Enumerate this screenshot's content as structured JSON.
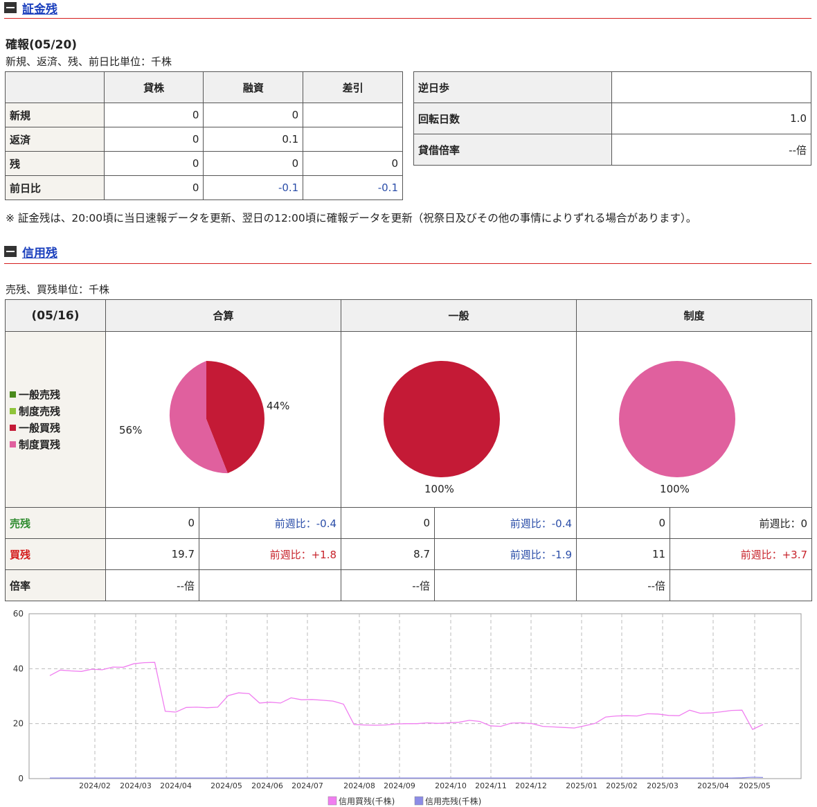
{
  "shoukin": {
    "title": "証金残",
    "status": "確報(05/20)",
    "unit_note": "新規、返済、残、前日比単位：千株",
    "columns": [
      "貸株",
      "融資",
      "差引"
    ],
    "rows": [
      {
        "label": "新規",
        "values": [
          "0",
          "0",
          ""
        ]
      },
      {
        "label": "返済",
        "values": [
          "0",
          "0.1",
          ""
        ]
      },
      {
        "label": "残",
        "values": [
          "0",
          "0",
          "0"
        ]
      },
      {
        "label": "前日比",
        "values": [
          "0",
          "-0.1",
          "-0.1"
        ]
      }
    ],
    "side": [
      {
        "label": "逆日歩",
        "value": ""
      },
      {
        "label": "回転日数",
        "value": "1.0"
      },
      {
        "label": "貸借倍率",
        "value": "--倍"
      }
    ],
    "note": "※ 証金残は、20:00頃に当日速報データを更新、翌日の12:00頃に確報データを更新（祝祭日及びその他の事情によりずれる場合があります）。"
  },
  "shinyou": {
    "title": "信用残",
    "unit_note": "売残、買残単位：千株",
    "date": "(05/16)",
    "columns": [
      "合算",
      "一般",
      "制度"
    ],
    "legend": [
      {
        "label": "一般売残",
        "color": "#4a8a1c"
      },
      {
        "label": "制度売残",
        "color": "#8fc43a"
      },
      {
        "label": "一般買残",
        "color": "#c41a36"
      },
      {
        "label": "制度買残",
        "color": "#e0609e"
      }
    ],
    "pie_labels": {
      "gassan_a": "44%",
      "gassan_b": "56%",
      "ippan": "100%",
      "seido": "100%"
    },
    "rows": {
      "uri": {
        "label": "売残",
        "cells": [
          "0",
          "前週比：-0.4",
          "0",
          "前週比：-0.4",
          "0",
          "前週比：0"
        ]
      },
      "kai": {
        "label": "買残",
        "cells": [
          "19.7",
          "前週比：+1.8",
          "8.7",
          "前週比：-1.9",
          "11",
          "前週比：+3.7"
        ]
      },
      "bai": {
        "label": "倍率",
        "cells": [
          "--倍",
          "",
          "--倍",
          "",
          "--倍",
          ""
        ]
      }
    }
  },
  "chart_data": {
    "type": "line",
    "ylim": [
      0,
      60
    ],
    "yticks": [
      "0",
      "20",
      "40",
      "60"
    ],
    "xticks": [
      "2024/02",
      "2024/03",
      "2024/04",
      "2024/05",
      "2024/06",
      "2024/07",
      "2024/08",
      "2024/09",
      "2024/10",
      "2024/11",
      "2024/12",
      "2025/01",
      "2025/02",
      "2025/03",
      "2025/04",
      "2025/05"
    ],
    "series": [
      {
        "name": "信用買残(千株)",
        "color": "#f07ef0",
        "values": [
          37.5,
          39.5,
          39.2,
          39.0,
          39.8,
          39.6,
          40.6,
          40.5,
          41.8,
          42.2,
          42.3,
          24.5,
          24.2,
          25.9,
          26.0,
          25.8,
          26.0,
          30.2,
          31.2,
          30.9,
          27.5,
          27.8,
          27.5,
          29.4,
          28.7,
          28.8,
          28.5,
          28.2,
          27.1,
          19.7,
          19.5,
          19.4,
          19.5,
          19.9,
          20.0,
          20.0,
          20.3,
          20.1,
          20.3,
          20.5,
          21.2,
          20.8,
          19.2,
          19.0,
          20.2,
          20.3,
          20.0,
          19.0,
          18.8,
          18.6,
          18.4,
          19.2,
          20.1,
          22.4,
          22.8,
          22.9,
          22.8,
          23.6,
          23.5,
          23.0,
          22.9,
          24.9,
          23.8,
          23.9,
          24.3,
          24.8,
          24.9,
          17.9,
          19.7
        ]
      },
      {
        "name": "信用売残(千株)",
        "color": "#8c8ce6",
        "values": [
          0.2,
          0.2,
          0.2,
          0.2,
          0.2,
          0.2,
          0.2,
          0.2,
          0.2,
          0.2,
          0.2,
          0.2,
          0.2,
          0.2,
          0.2,
          0.2,
          0.2,
          0.2,
          0.2,
          0.2,
          0.2,
          0.2,
          0.2,
          0.2,
          0.2,
          0.2,
          0.2,
          0.2,
          0.2,
          0.2,
          0.2,
          0.2,
          0.2,
          0.2,
          0.2,
          0.2,
          0.2,
          0.2,
          0.2,
          0.2,
          0.2,
          0.2,
          0.2,
          0.2,
          0.2,
          0.2,
          0.2,
          0.2,
          0.2,
          0.2,
          0.2,
          0.2,
          0.2,
          0.2,
          0.2,
          0.2,
          0.2,
          0.2,
          0.2,
          0.2,
          0.2,
          0.2,
          0.2,
          0.2,
          0.2,
          0.2,
          0.3,
          0.5,
          0.4
        ]
      }
    ]
  }
}
